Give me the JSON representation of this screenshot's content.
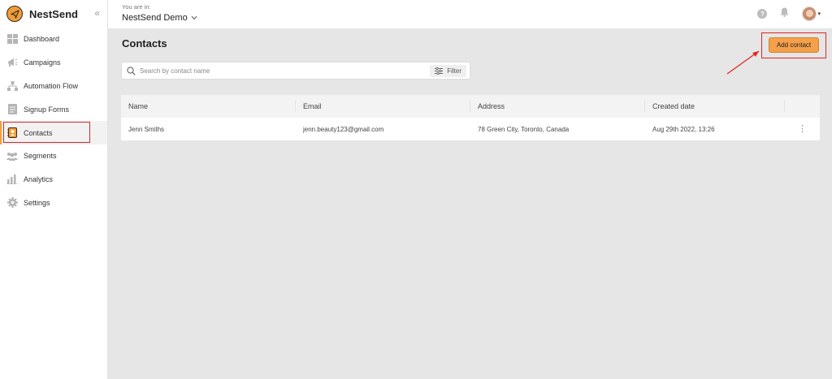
{
  "brand": {
    "name": "NestSend",
    "collapse_icon": "«"
  },
  "sidebar": {
    "items": [
      {
        "label": "Dashboard",
        "icon": "dashboard-icon"
      },
      {
        "label": "Campaigns",
        "icon": "megaphone-icon"
      },
      {
        "label": "Automation Flow",
        "icon": "flow-icon"
      },
      {
        "label": "Signup Forms",
        "icon": "form-icon"
      },
      {
        "label": "Contacts",
        "icon": "contacts-icon",
        "active": true
      },
      {
        "label": "Segments",
        "icon": "segments-icon"
      },
      {
        "label": "Analytics",
        "icon": "analytics-icon"
      },
      {
        "label": "Settings",
        "icon": "gear-icon"
      }
    ]
  },
  "header": {
    "workspace_label": "You are in:",
    "workspace_name": "NestSend Demo",
    "help_glyph": "?"
  },
  "main": {
    "title": "Contacts",
    "add_button_label": "Add contact",
    "search_placeholder": "Search by contact name",
    "filter_label": "Filter"
  },
  "table": {
    "columns": [
      "Name",
      "Email",
      "Address",
      "Created date"
    ],
    "rows": [
      {
        "name": "Jenn Smiths",
        "email": "jenn.beauty123@gmail.com",
        "address": "78 Green City, Toronto, Canada",
        "created": "Aug 29th 2022, 13:26"
      }
    ]
  },
  "colors": {
    "accent": "#f5a04a",
    "highlight": "#e02424"
  }
}
